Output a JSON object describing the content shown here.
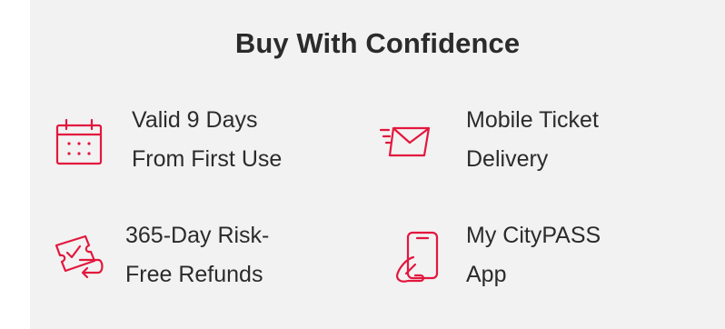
{
  "section": {
    "title": "Buy With Confidence"
  },
  "features": [
    {
      "line1": "Valid 9 Days",
      "line2": "From First Use",
      "icon": "calendar-icon"
    },
    {
      "line1": "Mobile Ticket",
      "line2": "Delivery",
      "icon": "mail-send-icon"
    },
    {
      "line1": "365-Day Risk-",
      "line2": "Free Refunds",
      "icon": "refund-ticket-icon"
    },
    {
      "line1": "My CityPASS",
      "line2": "App",
      "icon": "mobile-app-icon"
    }
  ],
  "colors": {
    "accent": "#e3173d",
    "panel_bg": "#f2f2f2",
    "text": "#2b2b2b"
  }
}
